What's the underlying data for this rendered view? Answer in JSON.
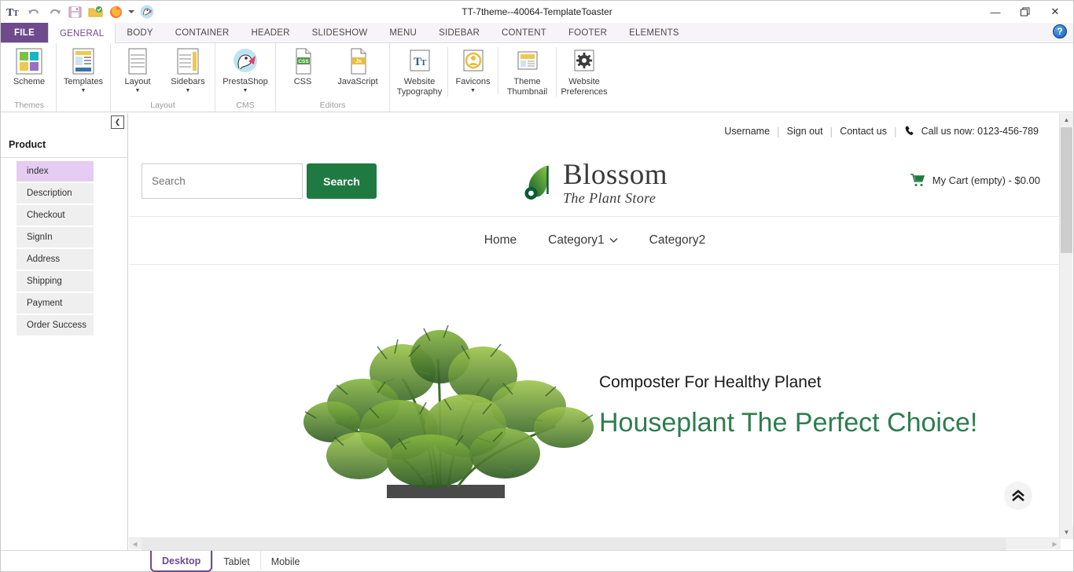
{
  "window": {
    "title": "TT-7theme--40064-TemplateToaster",
    "minimize": "—",
    "maximize": "❐",
    "close": "✕",
    "help": "?"
  },
  "quick_access": [
    {
      "name": "typography-icon",
      "glyph": "Tᴛ"
    },
    {
      "name": "undo-icon",
      "glyph": "↶"
    },
    {
      "name": "redo-icon",
      "glyph": "↷"
    },
    {
      "name": "save-icon",
      "glyph": "Ὃe"
    },
    {
      "name": "open-folder-icon",
      "glyph": "Ὄ1"
    },
    {
      "name": "preview-firefox-icon",
      "glyph": "●"
    },
    {
      "name": "dropdown-caret-icon",
      "glyph": "▾"
    },
    {
      "name": "prestashop-icon",
      "glyph": "●"
    }
  ],
  "ribbon": {
    "file_tab": "FILE",
    "tabs": [
      {
        "label": "GENERAL",
        "active": true
      },
      {
        "label": "BODY",
        "active": false
      },
      {
        "label": "CONTAINER",
        "active": false
      },
      {
        "label": "HEADER",
        "active": false
      },
      {
        "label": "SLIDESHOW",
        "active": false
      },
      {
        "label": "MENU",
        "active": false
      },
      {
        "label": "SIDEBAR",
        "active": false
      },
      {
        "label": "CONTENT",
        "active": false
      },
      {
        "label": "FOOTER",
        "active": false
      },
      {
        "label": "ELEMENTS",
        "active": false
      }
    ],
    "groups": [
      {
        "label": "Themes",
        "items": [
          {
            "label": "Scheme",
            "icon": "color-scheme-icon",
            "has_caret": false
          }
        ]
      },
      {
        "label": "",
        "items": [
          {
            "label": "Templates",
            "icon": "templates-icon",
            "has_caret": true
          }
        ]
      },
      {
        "label": "Layout",
        "items": [
          {
            "label": "Layout",
            "icon": "layout-icon",
            "has_caret": true
          },
          {
            "label": "Sidebars",
            "icon": "sidebars-icon",
            "has_caret": true
          }
        ]
      },
      {
        "label": "CMS",
        "items": [
          {
            "label": "PrestaShop",
            "icon": "prestashop-icon",
            "has_caret": true
          }
        ]
      },
      {
        "label": "Editors",
        "items": [
          {
            "label": "CSS",
            "icon": "css-file-icon",
            "has_caret": false
          },
          {
            "label": "JavaScript",
            "icon": "js-file-icon",
            "has_caret": false
          }
        ]
      },
      {
        "label": "",
        "items": [
          {
            "label": "Website\nTypography",
            "icon": "typography-icon",
            "has_caret": false
          },
          {
            "label": "Favicons",
            "icon": "favicon-icon",
            "has_caret": true
          },
          {
            "label": "Theme\nThumbnail",
            "icon": "thumbnail-icon",
            "has_caret": false
          },
          {
            "label": "Website\nPreferences",
            "icon": "gear-icon",
            "has_caret": false
          }
        ]
      }
    ]
  },
  "left_panel": {
    "collapse_glyph": "❮",
    "title": "Product",
    "items": [
      {
        "label": "index",
        "active": true
      },
      {
        "label": "Description",
        "active": false
      },
      {
        "label": "Checkout",
        "active": false
      },
      {
        "label": "SignIn",
        "active": false
      },
      {
        "label": "Address",
        "active": false
      },
      {
        "label": "Shipping",
        "active": false
      },
      {
        "label": "Payment",
        "active": false
      },
      {
        "label": "Order Success",
        "active": false
      }
    ]
  },
  "site": {
    "top_bar": {
      "username": "Username",
      "sign_out": "Sign out",
      "contact_us": "Contact us",
      "phone": "Call us now: 0123-456-789"
    },
    "search": {
      "value": "",
      "placeholder": "Search",
      "button_label": "Search"
    },
    "logo": {
      "name": "Blossom",
      "tagline": "The Plant Store"
    },
    "cart": "My Cart (empty) - $0.00",
    "nav": [
      {
        "label": "Home",
        "has_caret": false
      },
      {
        "label": "Category1",
        "has_caret": true
      },
      {
        "label": "Category2",
        "has_caret": false
      }
    ],
    "hero": {
      "subtitle": "Composter For Healthy Planet",
      "title": "Houseplant The Perfect Choice!",
      "scroll_top_glyph": "«"
    }
  },
  "device_tabs": [
    {
      "label": "Desktop",
      "active": true
    },
    {
      "label": "Tablet",
      "active": false
    },
    {
      "label": "Mobile",
      "active": false
    }
  ],
  "colors": {
    "accent_purple": "#6f4b8e",
    "brand_green": "#1f7a41",
    "hero_green": "#2e7d4f",
    "active_item_lilac": "#e4ccf2"
  }
}
